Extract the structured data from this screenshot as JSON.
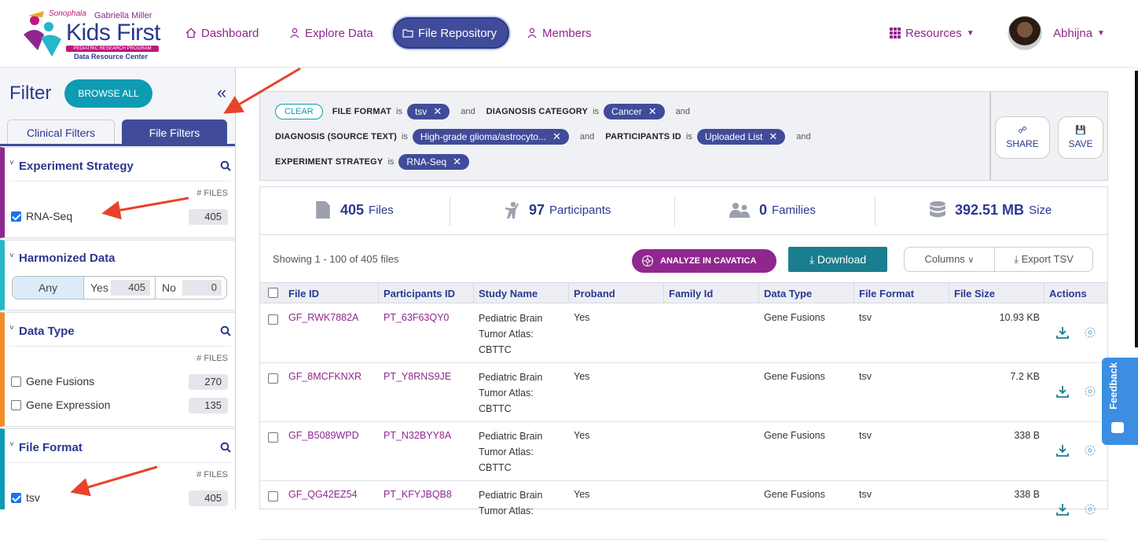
{
  "brand": {
    "byline": "Sonophala",
    "name_small": "Gabriella Miller",
    "name_big": "Kids First",
    "program": "PEDIATRIC RESEARCH PROGRAM",
    "subtitle": "Data Resource Center"
  },
  "nav": {
    "dashboard": "Dashboard",
    "explore": "Explore Data",
    "files": "File Repository",
    "members": "Members",
    "resources": "Resources",
    "user": "Abhijna"
  },
  "sidebar": {
    "title": "Filter",
    "browse_all": "BROWSE ALL",
    "collapse": "«",
    "tabs": [
      "Clinical Filters",
      "File Filters"
    ],
    "nfiles_label": "# FILES",
    "experiment": {
      "title": "Experiment Strategy",
      "items": [
        {
          "label": "RNA-Seq",
          "count": "405",
          "checked": true
        }
      ]
    },
    "harmonized": {
      "title": "Harmonized Data",
      "any": "Any",
      "yes": "Yes",
      "yes_count": "405",
      "no": "No",
      "no_count": "0"
    },
    "datatype": {
      "title": "Data Type",
      "items": [
        {
          "label": "Gene Fusions",
          "count": "270"
        },
        {
          "label": "Gene Expression",
          "count": "135"
        }
      ]
    },
    "fileformat": {
      "title": "File Format",
      "items": [
        {
          "label": "tsv",
          "count": "405",
          "checked": true
        }
      ]
    }
  },
  "query": {
    "clear": "CLEAR",
    "is": "is",
    "and": "and",
    "f1": "FILE FORMAT",
    "v1": "tsv",
    "f2": "DIAGNOSIS CATEGORY",
    "v2": "Cancer",
    "f3": "DIAGNOSIS (SOURCE TEXT)",
    "v3": "High-grade glioma/astrocyto...",
    "f4": "PARTICIPANTS ID",
    "v4": "Uploaded List",
    "f5": "EXPERIMENT STRATEGY",
    "v5": "RNA-Seq",
    "share": "SHARE",
    "save": "SAVE"
  },
  "stats": {
    "files_num": "405",
    "files_label": "Files",
    "participants_num": "97",
    "participants_label": "Participants",
    "families_num": "0",
    "families_label": "Families",
    "size_num": "392.51 MB",
    "size_label": "Size"
  },
  "toolbar": {
    "showing": "Showing 1 - 100 of 405 files",
    "cavatica": "ANALYZE IN CAVATICA",
    "download": "Download",
    "columns": "Columns",
    "export": "Export TSV"
  },
  "table": {
    "headers": [
      "File ID",
      "Participants ID",
      "Study Name",
      "Proband",
      "Family Id",
      "Data Type",
      "File Format",
      "File Size",
      "Actions"
    ],
    "rows": [
      {
        "file_id": "GF_RWK7882A",
        "participant": "PT_63F63QY0",
        "study1": "Pediatric Brain",
        "study2": "Tumor Atlas:",
        "study3": "CBTTC",
        "proband": "Yes",
        "family": "",
        "datatype": "Gene Fusions",
        "format": "tsv",
        "size": "10.93 KB"
      },
      {
        "file_id": "GF_8MCFKNXR",
        "participant": "PT_Y8RNS9JE",
        "study1": "Pediatric Brain",
        "study2": "Tumor Atlas:",
        "study3": "CBTTC",
        "proband": "Yes",
        "family": "",
        "datatype": "Gene Fusions",
        "format": "tsv",
        "size": "7.2 KB"
      },
      {
        "file_id": "GF_B5089WPD",
        "participant": "PT_N32BYY8A",
        "study1": "Pediatric Brain",
        "study2": "Tumor Atlas:",
        "study3": "CBTTC",
        "proband": "Yes",
        "family": "",
        "datatype": "Gene Fusions",
        "format": "tsv",
        "size": "338 B"
      },
      {
        "file_id": "GF_QG42EZ54",
        "participant": "PT_KFYJBQB8",
        "study1": "Pediatric Brain",
        "study2": "Tumor Atlas:",
        "study3": "",
        "proband": "Yes",
        "family": "",
        "datatype": "Gene Fusions",
        "format": "tsv",
        "size": "338 B"
      }
    ]
  },
  "feedback": "Feedback",
  "colors": {
    "primary": "#2b388f",
    "accent": "#90278e",
    "teal": "#0f9bb4",
    "annotation_arrow": "#e8422a"
  }
}
